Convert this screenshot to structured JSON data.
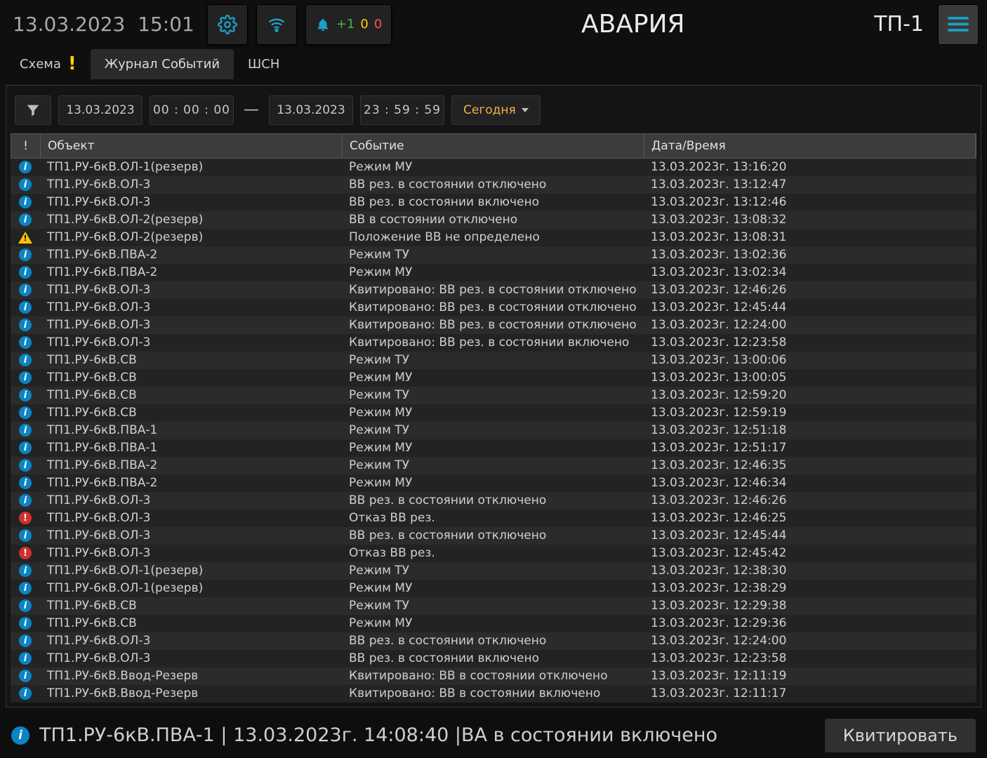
{
  "header": {
    "date": "13.03.2023",
    "time": "15:01",
    "title": "АВАРИЯ",
    "station": "ТП-1",
    "notif": {
      "plus": "+1",
      "yellow": "0",
      "red": "0"
    }
  },
  "tabs": {
    "schema": "Схема",
    "journal": "Журнал Событий",
    "shsn": "ШСН"
  },
  "filter": {
    "date_from": "13.03.2023",
    "time_from": "00 : 00 : 00",
    "dash": "—",
    "date_to": "13.03.2023",
    "time_to": "23 : 59 : 59",
    "today": "Сегодня"
  },
  "columns": {
    "sev": "!",
    "obj": "Объект",
    "evt": "Событие",
    "dt": "Дата/Время"
  },
  "rows": [
    {
      "sev": "info",
      "obj": "ТП1.РУ-6кВ.ОЛ-1(резерв)",
      "evt": "Режим МУ",
      "dt": "13.03.2023г. 13:16:20"
    },
    {
      "sev": "info",
      "obj": "ТП1.РУ-6кВ.ОЛ-3",
      "evt": "ВВ рез. в состоянии отключено",
      "dt": "13.03.2023г. 13:12:47"
    },
    {
      "sev": "info",
      "obj": "ТП1.РУ-6кВ.ОЛ-3",
      "evt": "ВВ рез. в состоянии включено",
      "dt": "13.03.2023г. 13:12:46"
    },
    {
      "sev": "info",
      "obj": "ТП1.РУ-6кВ.ОЛ-2(резерв)",
      "evt": "ВВ в состоянии отключено",
      "dt": "13.03.2023г. 13:08:32"
    },
    {
      "sev": "warn",
      "obj": "ТП1.РУ-6кВ.ОЛ-2(резерв)",
      "evt": "Положение ВВ не определено",
      "dt": "13.03.2023г. 13:08:31"
    },
    {
      "sev": "info",
      "obj": "ТП1.РУ-6кВ.ПВА-2",
      "evt": "Режим ТУ",
      "dt": "13.03.2023г. 13:02:36"
    },
    {
      "sev": "info",
      "obj": "ТП1.РУ-6кВ.ПВА-2",
      "evt": "Режим МУ",
      "dt": "13.03.2023г. 13:02:34"
    },
    {
      "sev": "info",
      "obj": "ТП1.РУ-6кВ.ОЛ-3",
      "evt": "Квитировано: ВВ рез. в состоянии отключено",
      "dt": "13.03.2023г. 12:46:26"
    },
    {
      "sev": "info",
      "obj": "ТП1.РУ-6кВ.ОЛ-3",
      "evt": "Квитировано: ВВ рез. в состоянии отключено",
      "dt": "13.03.2023г. 12:45:44"
    },
    {
      "sev": "info",
      "obj": "ТП1.РУ-6кВ.ОЛ-3",
      "evt": "Квитировано: ВВ рез. в состоянии отключено",
      "dt": "13.03.2023г. 12:24:00"
    },
    {
      "sev": "info",
      "obj": "ТП1.РУ-6кВ.ОЛ-3",
      "evt": "Квитировано: ВВ рез. в состоянии включено",
      "dt": "13.03.2023г. 12:23:58"
    },
    {
      "sev": "info",
      "obj": "ТП1.РУ-6кВ.СВ",
      "evt": "Режим ТУ",
      "dt": "13.03.2023г. 13:00:06"
    },
    {
      "sev": "info",
      "obj": "ТП1.РУ-6кВ.СВ",
      "evt": "Режим МУ",
      "dt": "13.03.2023г. 13:00:05"
    },
    {
      "sev": "info",
      "obj": "ТП1.РУ-6кВ.СВ",
      "evt": "Режим ТУ",
      "dt": "13.03.2023г. 12:59:20"
    },
    {
      "sev": "info",
      "obj": "ТП1.РУ-6кВ.СВ",
      "evt": "Режим МУ",
      "dt": "13.03.2023г. 12:59:19"
    },
    {
      "sev": "info",
      "obj": "ТП1.РУ-6кВ.ПВА-1",
      "evt": "Режим ТУ",
      "dt": "13.03.2023г. 12:51:18"
    },
    {
      "sev": "info",
      "obj": "ТП1.РУ-6кВ.ПВА-1",
      "evt": "Режим МУ",
      "dt": "13.03.2023г. 12:51:17"
    },
    {
      "sev": "info",
      "obj": "ТП1.РУ-6кВ.ПВА-2",
      "evt": "Режим ТУ",
      "dt": "13.03.2023г. 12:46:35"
    },
    {
      "sev": "info",
      "obj": "ТП1.РУ-6кВ.ПВА-2",
      "evt": "Режим МУ",
      "dt": "13.03.2023г. 12:46:34"
    },
    {
      "sev": "info",
      "obj": "ТП1.РУ-6кВ.ОЛ-3",
      "evt": "ВВ рез. в состоянии отключено",
      "dt": "13.03.2023г. 12:46:26"
    },
    {
      "sev": "error",
      "obj": "ТП1.РУ-6кВ.ОЛ-3",
      "evt": "Отказ ВВ рез.",
      "dt": "13.03.2023г. 12:46:25"
    },
    {
      "sev": "info",
      "obj": "ТП1.РУ-6кВ.ОЛ-3",
      "evt": "ВВ рез. в состоянии отключено",
      "dt": "13.03.2023г. 12:45:44"
    },
    {
      "sev": "error",
      "obj": "ТП1.РУ-6кВ.ОЛ-3",
      "evt": "Отказ ВВ рез.",
      "dt": "13.03.2023г. 12:45:42"
    },
    {
      "sev": "info",
      "obj": "ТП1.РУ-6кВ.ОЛ-1(резерв)",
      "evt": "Режим ТУ",
      "dt": "13.03.2023г. 12:38:30"
    },
    {
      "sev": "info",
      "obj": "ТП1.РУ-6кВ.ОЛ-1(резерв)",
      "evt": "Режим МУ",
      "dt": "13.03.2023г. 12:38:29"
    },
    {
      "sev": "info",
      "obj": "ТП1.РУ-6кВ.СВ",
      "evt": "Режим ТУ",
      "dt": "13.03.2023г. 12:29:38"
    },
    {
      "sev": "info",
      "obj": "ТП1.РУ-6кВ.СВ",
      "evt": "Режим МУ",
      "dt": "13.03.2023г. 12:29:36"
    },
    {
      "sev": "info",
      "obj": "ТП1.РУ-6кВ.ОЛ-3",
      "evt": "ВВ рез. в состоянии отключено",
      "dt": "13.03.2023г. 12:24:00"
    },
    {
      "sev": "info",
      "obj": "ТП1.РУ-6кВ.ОЛ-3",
      "evt": "ВВ рез. в состоянии включено",
      "dt": "13.03.2023г. 12:23:58"
    },
    {
      "sev": "info",
      "obj": "ТП1.РУ-6кВ.Ввод-Резерв",
      "evt": "Квитировано: ВВ в состоянии отключено",
      "dt": "13.03.2023г. 12:11:19"
    },
    {
      "sev": "info",
      "obj": "ТП1.РУ-6кВ.Ввод-Резерв",
      "evt": "Квитировано: ВВ в состоянии включено",
      "dt": "13.03.2023г. 12:11:17"
    }
  ],
  "footer": {
    "msg": "ТП1.РУ-6кВ.ПВА-1 | 13.03.2023г. 14:08:40 |ВА в состоянии включено",
    "ack": "Квитировать"
  }
}
